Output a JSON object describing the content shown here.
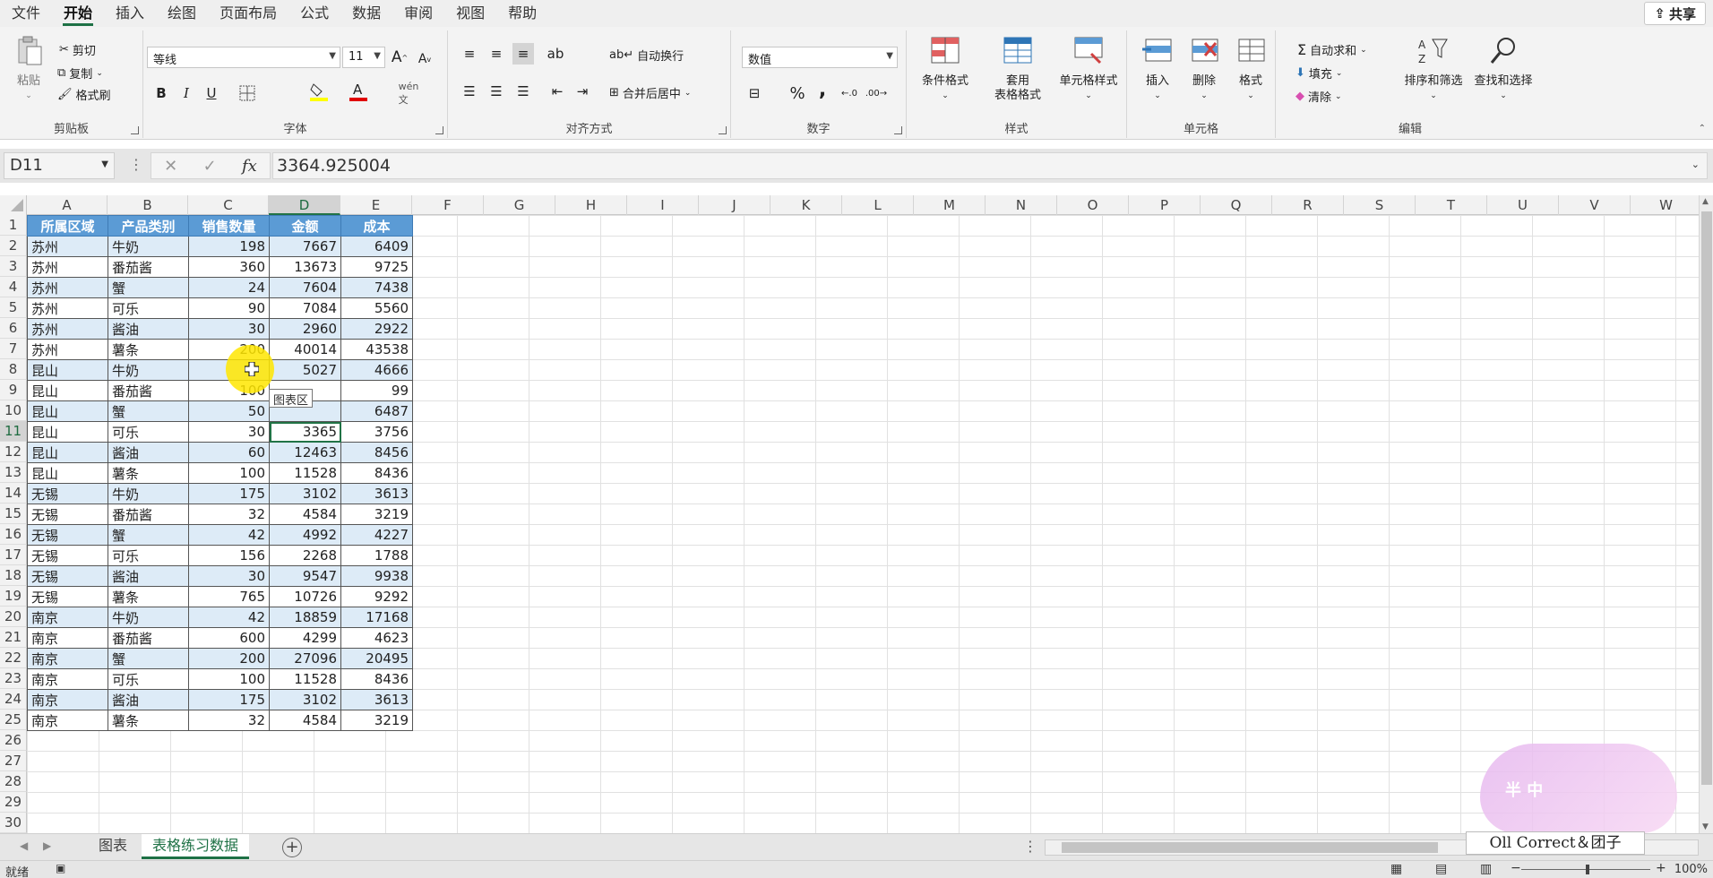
{
  "menu": {
    "tabs": [
      "文件",
      "开始",
      "插入",
      "绘图",
      "页面布局",
      "公式",
      "数据",
      "审阅",
      "视图",
      "帮助"
    ],
    "active": "开始",
    "share": "共享"
  },
  "ribbon": {
    "clipboard": {
      "label": "剪贴板",
      "paste": "粘贴",
      "cut": "剪切",
      "copy": "复制",
      "painter": "格式刷"
    },
    "font": {
      "label": "字体",
      "name": "等线",
      "size": "11",
      "bold": "B",
      "italic": "I",
      "underline": "U",
      "grow": "A",
      "shrink": "A"
    },
    "align": {
      "label": "对齐方式",
      "wrap": "自动换行",
      "merge": "合并后居中"
    },
    "number": {
      "label": "数字",
      "format": "数值",
      "percent": "%",
      "comma": ","
    },
    "styles": {
      "label": "样式",
      "conditional": "条件格式",
      "table_1": "套用",
      "table_2": "表格格式",
      "cell": "单元格样式"
    },
    "cells": {
      "label": "单元格",
      "insert": "插入",
      "delete": "删除",
      "format": "格式"
    },
    "edit": {
      "label": "编辑",
      "autosum": "自动求和",
      "fill": "填充",
      "clear": "清除",
      "sort": "排序和筛选",
      "find": "查找和选择"
    }
  },
  "formula_bar": {
    "name_box": "D11",
    "fx": "fx",
    "value": "3364.925004"
  },
  "columns": [
    "A",
    "B",
    "C",
    "D",
    "E",
    "F",
    "G",
    "H",
    "I",
    "J",
    "K",
    "L",
    "M",
    "N",
    "O",
    "P",
    "Q",
    "R",
    "S",
    "T",
    "U",
    "V",
    "W"
  ],
  "selected_column": "D",
  "selected_row": 11,
  "rows": [
    "1",
    "2",
    "3",
    "4",
    "5",
    "6",
    "7",
    "8",
    "9",
    "10",
    "11",
    "12",
    "13",
    "14",
    "15",
    "16",
    "17",
    "18",
    "19",
    "20",
    "21",
    "22",
    "23",
    "24",
    "25",
    "26",
    "27",
    "28",
    "29",
    "30"
  ],
  "table": {
    "headers": [
      "所属区域",
      "产品类别",
      "销售数量",
      "金额",
      "成本"
    ],
    "data": [
      [
        "苏州",
        "牛奶",
        "198",
        "7667",
        "6409"
      ],
      [
        "苏州",
        "番茄酱",
        "360",
        "13673",
        "9725"
      ],
      [
        "苏州",
        "蟹",
        "24",
        "7604",
        "7438"
      ],
      [
        "苏州",
        "可乐",
        "90",
        "7084",
        "5560"
      ],
      [
        "苏州",
        "酱油",
        "30",
        "2960",
        "2922"
      ],
      [
        "苏州",
        "薯条",
        "200",
        "40014",
        "43538"
      ],
      [
        "昆山",
        "牛奶",
        "",
        "5027",
        "4666"
      ],
      [
        "昆山",
        "番茄酱",
        "100",
        "",
        "99"
      ],
      [
        "昆山",
        "蟹",
        "50",
        "",
        "6487"
      ],
      [
        "昆山",
        "可乐",
        "30",
        "3365",
        "3756"
      ],
      [
        "昆山",
        "酱油",
        "60",
        "12463",
        "8456"
      ],
      [
        "昆山",
        "薯条",
        "100",
        "11528",
        "8436"
      ],
      [
        "无锡",
        "牛奶",
        "175",
        "3102",
        "3613"
      ],
      [
        "无锡",
        "番茄酱",
        "32",
        "4584",
        "3219"
      ],
      [
        "无锡",
        "蟹",
        "42",
        "4992",
        "4227"
      ],
      [
        "无锡",
        "可乐",
        "156",
        "2268",
        "1788"
      ],
      [
        "无锡",
        "酱油",
        "30",
        "9547",
        "9938"
      ],
      [
        "无锡",
        "薯条",
        "765",
        "10726",
        "9292"
      ],
      [
        "南京",
        "牛奶",
        "42",
        "18859",
        "17168"
      ],
      [
        "南京",
        "番茄酱",
        "600",
        "4299",
        "4623"
      ],
      [
        "南京",
        "蟹",
        "200",
        "27096",
        "20495"
      ],
      [
        "南京",
        "可乐",
        "100",
        "11528",
        "8436"
      ],
      [
        "南京",
        "酱油",
        "175",
        "3102",
        "3613"
      ],
      [
        "南京",
        "薯条",
        "32",
        "4584",
        "3219"
      ]
    ]
  },
  "tooltip": "图表区",
  "sheets": {
    "tabs": [
      "图表",
      "表格练习数据"
    ],
    "active": "表格练习数据"
  },
  "status": {
    "ready": "就绪",
    "zoom": "100%"
  },
  "watermark": "Oll Correct＆团子",
  "mascot_text": "半 中",
  "colors": {
    "accent": "#217346",
    "header_fill": "#5b9bd5",
    "band_fill": "#ddebf7"
  }
}
